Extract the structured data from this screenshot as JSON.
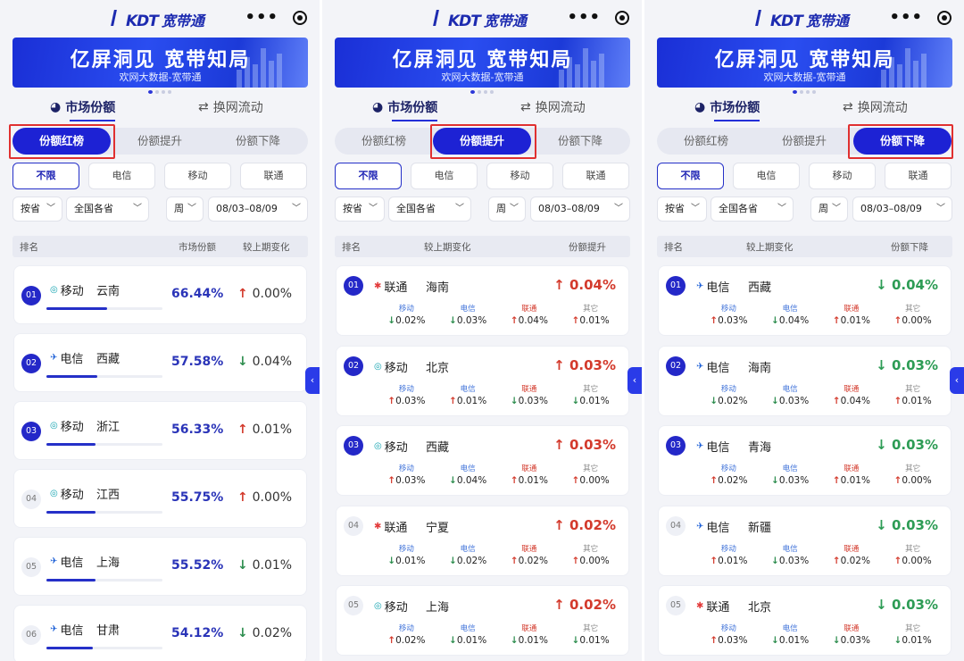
{
  "app": {
    "logo": "KDT",
    "name": "宽带通"
  },
  "banner": {
    "title": "亿屏洞见 宽带知局",
    "subtitle": "欢网大数据-宽带通"
  },
  "tabs": [
    "市场份额",
    "换网流动"
  ],
  "segments": [
    "份额红榜",
    "份额提升",
    "份额下降"
  ],
  "operators": [
    "不限",
    "电信",
    "移动",
    "联通"
  ],
  "filters": {
    "scope": "按省",
    "region": "全国各省",
    "period": "周",
    "range": "08/03–08/09"
  },
  "sub_labels": [
    "移动",
    "电信",
    "联通",
    "其它"
  ],
  "panels": [
    {
      "active_segment": 0,
      "header": [
        "排名",
        "市场份额",
        "较上期变化"
      ],
      "rows": [
        {
          "rank": "01",
          "op": "移动",
          "op_key": "m",
          "province": "云南",
          "share": "66.44%",
          "share_value": 0.6644,
          "change": "0.00%",
          "dir": "up"
        },
        {
          "rank": "02",
          "op": "电信",
          "op_key": "d",
          "province": "西藏",
          "share": "57.58%",
          "share_value": 0.5758,
          "change": "0.04%",
          "dir": "down"
        },
        {
          "rank": "03",
          "op": "移动",
          "op_key": "m",
          "province": "浙江",
          "share": "56.33%",
          "share_value": 0.5633,
          "change": "0.01%",
          "dir": "up"
        },
        {
          "rank": "04",
          "op": "移动",
          "op_key": "m",
          "province": "江西",
          "share": "55.75%",
          "share_value": 0.5575,
          "change": "0.00%",
          "dir": "up"
        },
        {
          "rank": "05",
          "op": "电信",
          "op_key": "d",
          "province": "上海",
          "share": "55.52%",
          "share_value": 0.5552,
          "change": "0.01%",
          "dir": "down"
        },
        {
          "rank": "06",
          "op": "电信",
          "op_key": "d",
          "province": "甘肃",
          "share": "54.12%",
          "share_value": 0.5412,
          "change": "0.02%",
          "dir": "down"
        }
      ]
    },
    {
      "active_segment": 1,
      "header": [
        "排名",
        "较上期变化",
        "份额提升"
      ],
      "rows": [
        {
          "rank": "01",
          "op": "联通",
          "op_key": "l",
          "province": "海南",
          "change": "0.04%",
          "dir": "up",
          "subs": [
            [
              "down",
              "0.02%"
            ],
            [
              "down",
              "0.03%"
            ],
            [
              "up",
              "0.04%"
            ],
            [
              "up",
              "0.01%"
            ]
          ]
        },
        {
          "rank": "02",
          "op": "移动",
          "op_key": "m",
          "province": "北京",
          "change": "0.03%",
          "dir": "up",
          "subs": [
            [
              "up",
              "0.03%"
            ],
            [
              "up",
              "0.01%"
            ],
            [
              "down",
              "0.03%"
            ],
            [
              "down",
              "0.01%"
            ]
          ]
        },
        {
          "rank": "03",
          "op": "移动",
          "op_key": "m",
          "province": "西藏",
          "change": "0.03%",
          "dir": "up",
          "subs": [
            [
              "up",
              "0.03%"
            ],
            [
              "down",
              "0.04%"
            ],
            [
              "up",
              "0.01%"
            ],
            [
              "up",
              "0.00%"
            ]
          ]
        },
        {
          "rank": "04",
          "op": "联通",
          "op_key": "l",
          "province": "宁夏",
          "change": "0.02%",
          "dir": "up",
          "subs": [
            [
              "down",
              "0.01%"
            ],
            [
              "down",
              "0.02%"
            ],
            [
              "up",
              "0.02%"
            ],
            [
              "up",
              "0.00%"
            ]
          ]
        },
        {
          "rank": "05",
          "op": "移动",
          "op_key": "m",
          "province": "上海",
          "change": "0.02%",
          "dir": "up",
          "subs": [
            [
              "up",
              "0.02%"
            ],
            [
              "down",
              "0.01%"
            ],
            [
              "down",
              "0.01%"
            ],
            [
              "down",
              "0.01%"
            ]
          ]
        }
      ]
    },
    {
      "active_segment": 2,
      "header": [
        "排名",
        "较上期变化",
        "份额下降"
      ],
      "rows": [
        {
          "rank": "01",
          "op": "电信",
          "op_key": "d",
          "province": "西藏",
          "change": "0.04%",
          "dir": "down",
          "subs": [
            [
              "up",
              "0.03%"
            ],
            [
              "down",
              "0.04%"
            ],
            [
              "up",
              "0.01%"
            ],
            [
              "up",
              "0.00%"
            ]
          ]
        },
        {
          "rank": "02",
          "op": "电信",
          "op_key": "d",
          "province": "海南",
          "change": "0.03%",
          "dir": "down",
          "subs": [
            [
              "down",
              "0.02%"
            ],
            [
              "down",
              "0.03%"
            ],
            [
              "up",
              "0.04%"
            ],
            [
              "up",
              "0.01%"
            ]
          ]
        },
        {
          "rank": "03",
          "op": "电信",
          "op_key": "d",
          "province": "青海",
          "change": "0.03%",
          "dir": "down",
          "subs": [
            [
              "up",
              "0.02%"
            ],
            [
              "down",
              "0.03%"
            ],
            [
              "up",
              "0.01%"
            ],
            [
              "up",
              "0.00%"
            ]
          ]
        },
        {
          "rank": "04",
          "op": "电信",
          "op_key": "d",
          "province": "新疆",
          "change": "0.03%",
          "dir": "down",
          "subs": [
            [
              "up",
              "0.01%"
            ],
            [
              "down",
              "0.03%"
            ],
            [
              "up",
              "0.02%"
            ],
            [
              "up",
              "0.00%"
            ]
          ]
        },
        {
          "rank": "05",
          "op": "联通",
          "op_key": "l",
          "province": "北京",
          "change": "0.03%",
          "dir": "down",
          "subs": [
            [
              "up",
              "0.03%"
            ],
            [
              "down",
              "0.01%"
            ],
            [
              "down",
              "0.03%"
            ],
            [
              "down",
              "0.01%"
            ]
          ]
        }
      ]
    }
  ],
  "colors": {
    "accent": "#1d22d4",
    "up": "#d33a2c",
    "down": "#2d8d4e",
    "highlight": "#e03030"
  }
}
